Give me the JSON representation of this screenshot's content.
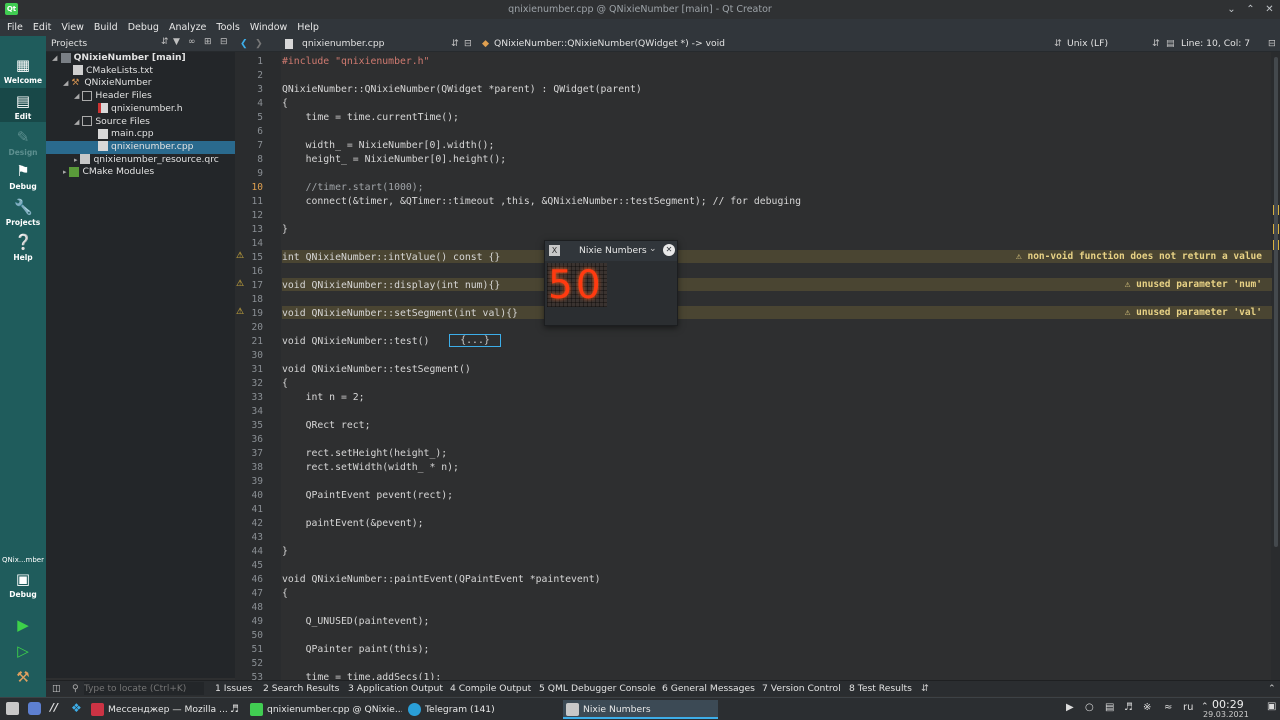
{
  "window": {
    "title": "qnixienumber.cpp @ QNixieNumber [main] - Qt Creator"
  },
  "menu": [
    "File",
    "Edit",
    "View",
    "Build",
    "Debug",
    "Analyze",
    "Tools",
    "Window",
    "Help"
  ],
  "modes": [
    {
      "label": "Welcome",
      "icon": "grid-icon"
    },
    {
      "label": "Edit",
      "icon": "edit-icon"
    },
    {
      "label": "Design",
      "icon": "pencil-icon"
    },
    {
      "label": "Debug",
      "icon": "bug-icon"
    },
    {
      "label": "Projects",
      "icon": "wrench-icon"
    },
    {
      "label": "Help",
      "icon": "help-icon"
    }
  ],
  "kit": {
    "name": "QNix...mber",
    "config": "Debug"
  },
  "projects_panel": {
    "title": "Projects",
    "tree": [
      {
        "label": "QNixieNumber [main]",
        "bold": true
      },
      {
        "label": "CMakeLists.txt"
      },
      {
        "label": "QNixieNumber"
      },
      {
        "label": "Header Files"
      },
      {
        "label": "qnixienumber.h"
      },
      {
        "label": "Source Files"
      },
      {
        "label": "main.cpp"
      },
      {
        "label": "qnixienumber.cpp",
        "selected": true
      },
      {
        "label": "qnixienumber_resource.qrc"
      },
      {
        "label": "CMake Modules"
      }
    ]
  },
  "editor_bar": {
    "file": "qnixienumber.cpp",
    "symbol": "QNixieNumber::QNixieNumber(QWidget *) -> void",
    "encoding": "Unix (LF)",
    "position": "Line: 10, Col: 7"
  },
  "code": {
    "line_numbers": [
      "1",
      "2",
      "3",
      "4",
      "5",
      "6",
      "7",
      "8",
      "9",
      "10",
      "11",
      "12",
      "13",
      "14",
      "15",
      "16",
      "17",
      "18",
      "19",
      "20",
      "21",
      "30",
      "31",
      "32",
      "33",
      "34",
      "35",
      "36",
      "37",
      "38",
      "39",
      "40",
      "41",
      "42",
      "43",
      "44",
      "45",
      "46",
      "47",
      "48",
      "49",
      "50",
      "51",
      "52",
      "53"
    ],
    "lines": [
      "#include \"qnixienumber.h\"",
      "",
      "QNixieNumber::QNixieNumber(QWidget *parent) : QWidget(parent)",
      "{",
      "    time = time.currentTime();",
      "",
      "    width_ = NixieNumber[0].width();",
      "    height_ = NixieNumber[0].height();",
      "",
      "    //timer.start(1000);",
      "    connect(&timer, &QTimer::timeout ,this, &QNixieNumber::testSegment); // for debuging",
      "",
      "}",
      "",
      "int QNixieNumber::intValue() const {}",
      "",
      "void QNixieNumber::display(int num){}",
      "",
      "void QNixieNumber::setSegment(int val){}",
      "",
      "void QNixieNumber::test() ",
      "",
      "void QNixieNumber::testSegment()",
      "{",
      "    int n = 2;",
      "",
      "    QRect rect;",
      "",
      "    rect.setHeight(height_);",
      "    rect.setWidth(width_ * n);",
      "",
      "    QPaintEvent pevent(rect);",
      "",
      "    paintEvent(&pevent);",
      "",
      "}",
      "",
      "void QNixieNumber::paintEvent(QPaintEvent *paintevent)",
      "{",
      "",
      "    Q_UNUSED(paintevent);",
      "",
      "    QPainter paint(this);",
      "",
      "    time = time.addSecs(1);"
    ],
    "folded_marker": "{...}",
    "warnings": [
      {
        "line": "15",
        "text": "⚠ non-void function does not return a value"
      },
      {
        "line": "17",
        "text": "⚠ unused parameter 'num'"
      },
      {
        "line": "19",
        "text": "⚠ unused parameter 'val'"
      }
    ]
  },
  "popup": {
    "title": "Nixie Numbers",
    "display_value": "50"
  },
  "output_tabs": {
    "locator_placeholder": "Type to locate (Ctrl+K)",
    "tabs": [
      "1 Issues",
      "2 Search Results",
      "3 Application Output",
      "4 Compile Output",
      "5 QML Debugger Console",
      "6 General Messages",
      "7 Version Control",
      "8 Test Results"
    ]
  },
  "taskbar": {
    "tasks": [
      "Мессенджер — Mozilla ...",
      "qnixienumber.cpp @ QNixie...",
      "Telegram (141)",
      "Nixie Numbers"
    ],
    "lang": "ru",
    "time": "00:29",
    "date": "29.03.2021"
  },
  "colors": {
    "modebar": "#1f5c5c",
    "selection": "#2a6a8e",
    "warning": "#e8d285",
    "nixie": "#ff3a10"
  }
}
